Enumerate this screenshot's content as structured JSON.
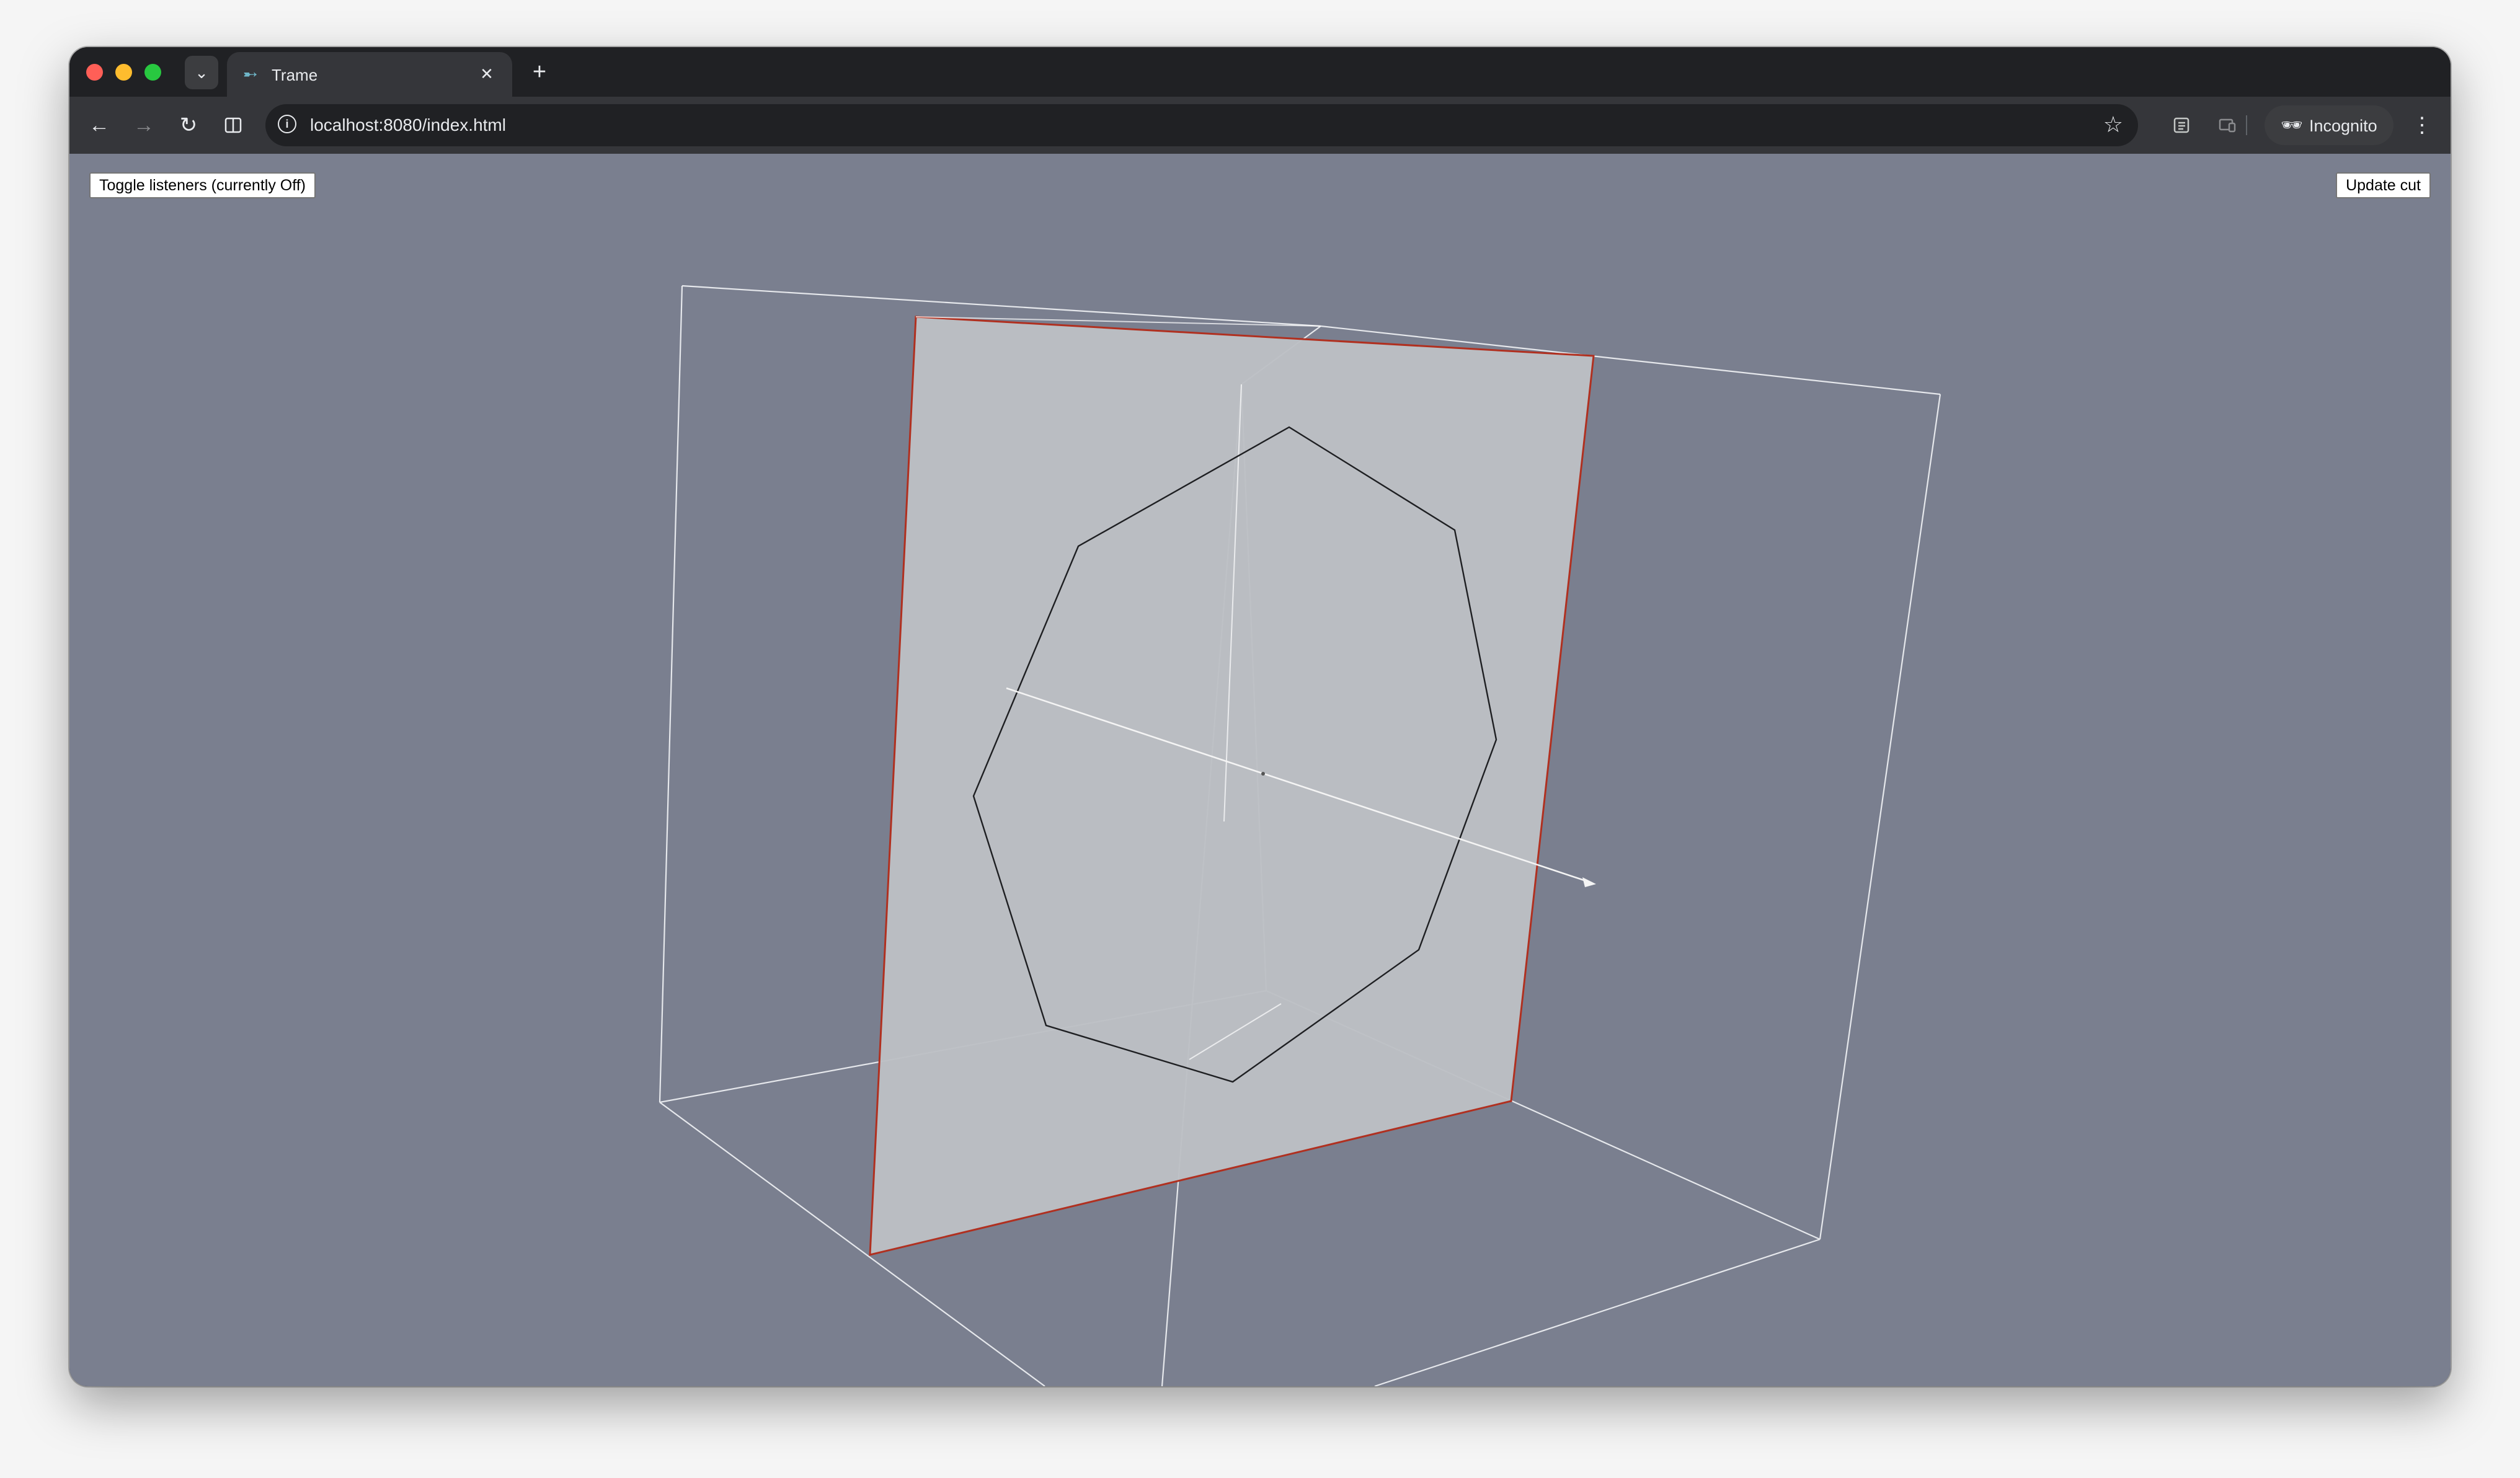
{
  "browser": {
    "tab": {
      "title": "Trame",
      "favicon": "trame-logo-icon"
    },
    "url": "localhost:8080/index.html",
    "incognito_label": "Incognito",
    "icons": {
      "tab_search": "chevron-down-icon",
      "tab_close": "close-icon",
      "new_tab": "plus-icon",
      "back": "back-arrow-icon",
      "forward": "forward-arrow-icon",
      "reload": "reload-icon",
      "split_view": "split-view-icon",
      "site_info": "info-icon",
      "bookmark": "star-icon",
      "reading_list": "reading-list-icon",
      "cast": "cast-icon",
      "incognito": "incognito-icon",
      "menu": "kebab-menu-icon"
    }
  },
  "app": {
    "toggle_listeners_label": "Toggle listeners (currently Off)",
    "update_cut_label": "Update cut",
    "colors": {
      "background": "#7a7f8f",
      "plane_fill": "#bcbfc4",
      "plane_edge": "#b03020",
      "outline": "#e6e8ec",
      "cut_contour": "#1e1f22",
      "normal_arrow": "#f4f4f4"
    }
  }
}
